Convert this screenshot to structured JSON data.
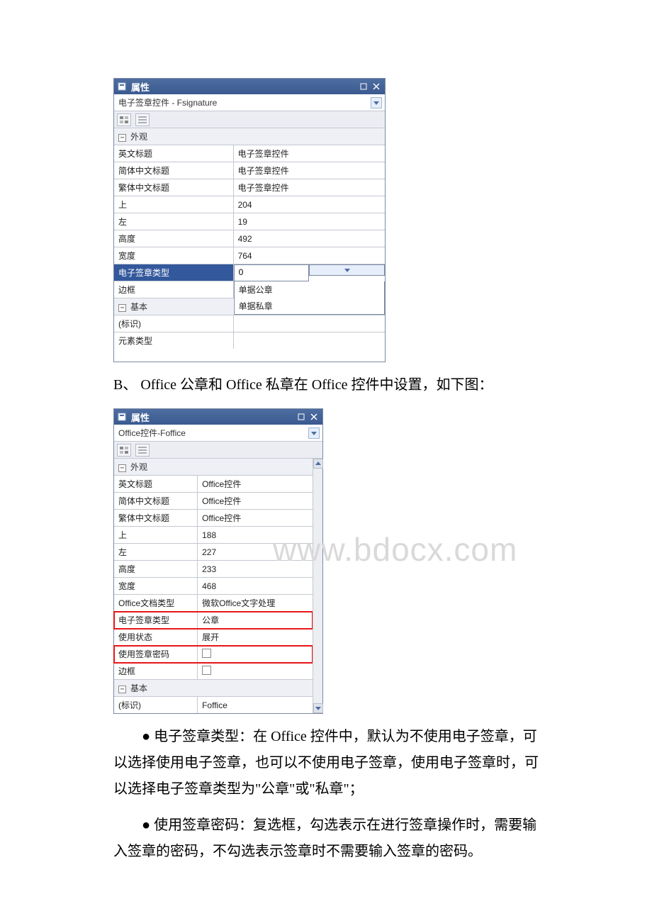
{
  "panel1": {
    "title": "属性",
    "combo": "电子签章控件 - Fsignature",
    "sections": {
      "appearance_label": "外观",
      "basic_label": "基本"
    },
    "rows": {
      "en_title": {
        "label": "英文标题",
        "value": "电子签章控件"
      },
      "zh_cn_title": {
        "label": "简体中文标题",
        "value": "电子签章控件"
      },
      "zh_tw_title": {
        "label": "繁体中文标题",
        "value": "电子签章控件"
      },
      "top": {
        "label": "上",
        "value": "204"
      },
      "left": {
        "label": "左",
        "value": "19"
      },
      "height": {
        "label": "高度",
        "value": "492"
      },
      "width": {
        "label": "宽度",
        "value": "764"
      },
      "sign_type": {
        "label": "电子签章类型",
        "value": "0"
      },
      "border": {
        "label": "边框",
        "value": ""
      },
      "id": {
        "label": "(标识)",
        "value": ""
      },
      "elem_type": {
        "label": "元素类型",
        "value": ""
      }
    },
    "dropdown": {
      "opt1": "单据公章",
      "opt2": "单据私章"
    }
  },
  "mid_text": "B、 Office 公章和 Office 私章在 Office 控件中设置，如下图：",
  "panel2": {
    "title": "属性",
    "combo": "Office控件-Foffice",
    "sections": {
      "appearance_label": "外观",
      "basic_label": "基本"
    },
    "rows": {
      "en_title": {
        "label": "英文标题",
        "value": "Office控件"
      },
      "zh_cn_title": {
        "label": "简体中文标题",
        "value": "Office控件"
      },
      "zh_tw_title": {
        "label": "繁体中文标题",
        "value": "Office控件"
      },
      "top": {
        "label": "上",
        "value": "188"
      },
      "left": {
        "label": "左",
        "value": "227"
      },
      "height": {
        "label": "高度",
        "value": "233"
      },
      "width": {
        "label": "宽度",
        "value": "468"
      },
      "doc_type": {
        "label": "Office文档类型",
        "value": "微软Office文字处理"
      },
      "sign_type": {
        "label": "电子签章类型",
        "value": "公章"
      },
      "use_state": {
        "label": "使用状态",
        "value": "展开"
      },
      "use_pwd": {
        "label": "使用签章密码",
        "value": ""
      },
      "border": {
        "label": "边框",
        "value": ""
      },
      "id": {
        "label": "(标识)",
        "value": "Foffice"
      }
    }
  },
  "watermark_text": "www.bdocx.com",
  "body_text": {
    "p1": "● 电子签章类型：在 Office 控件中，默认为不使用电子签章，可以选择使用电子签章，也可以不使用电子签章，使用电子签章时，可以选择电子签章类型为\"公章\"或\"私章\"；",
    "p2": "● 使用签章密码：复选框，勾选表示在进行签章操作时，需要输入签章的密码，不勾选表示签章时不需要输入签章的密码。"
  }
}
